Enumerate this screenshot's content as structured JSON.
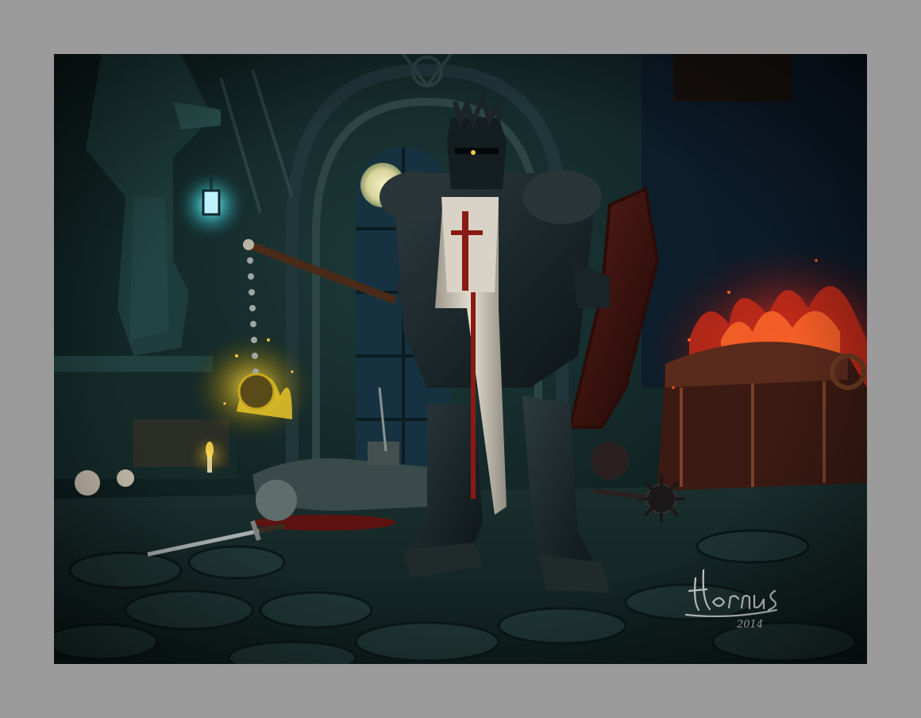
{
  "frame": {
    "mat_color": "#9b9b9b"
  },
  "artwork": {
    "signature": "Horus 2014",
    "palette": {
      "shadow": "#0b1a1b",
      "stone": "#1f3433",
      "teal_glow": "#4fd3d0",
      "fire": "#e0361c",
      "gold_fire": "#d6b21a",
      "tabard": "#d9d4c8",
      "cross": "#8a1a14"
    }
  }
}
